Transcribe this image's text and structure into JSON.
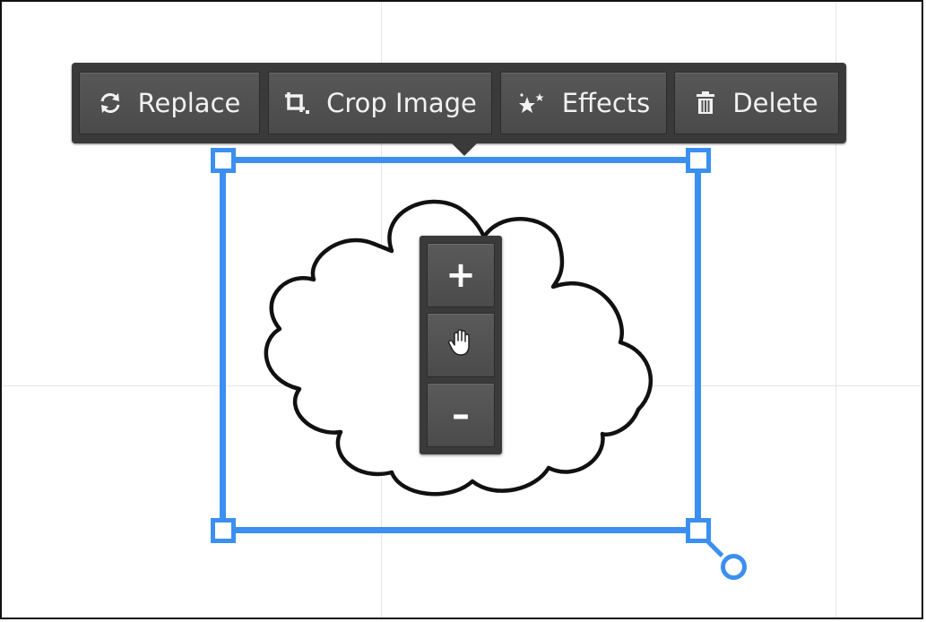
{
  "toolbar": {
    "replace": {
      "label": "Replace",
      "icon": "refresh-icon"
    },
    "crop": {
      "label": "Crop Image",
      "icon": "crop-icon"
    },
    "effects": {
      "label": "Effects",
      "icon": "sparkle-icon"
    },
    "delete": {
      "label": "Delete",
      "icon": "trash-icon"
    }
  },
  "zoom": {
    "in_label": "+",
    "pan_icon": "hand-icon",
    "out_label": "–"
  },
  "image": {
    "subject": "cloud-drawing"
  },
  "colors": {
    "selection": "#3b8ff0",
    "toolbar_bg": "#3a3a3a",
    "button_bg": "#505050",
    "button_text": "#f1f1f1"
  }
}
